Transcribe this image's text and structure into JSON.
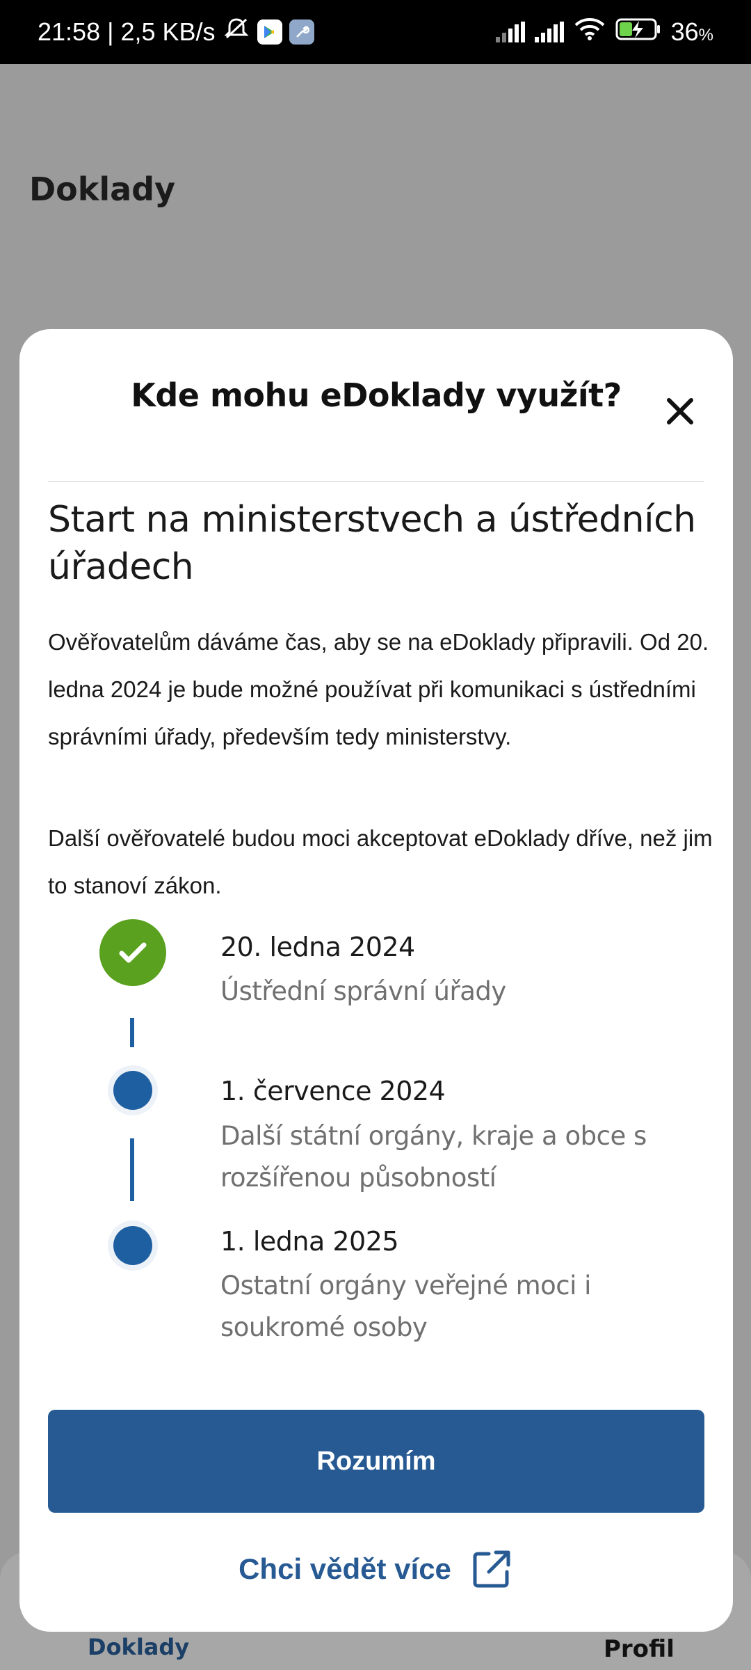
{
  "status_bar": {
    "time_speed": "21:58 | 2,5 KB/s",
    "battery": "36",
    "battery_unit": "%",
    "icons": [
      "mute-icon",
      "play-store-icon",
      "wrench-icon",
      "signal-icon",
      "signal-icon",
      "wifi-icon",
      "battery-charging-icon"
    ]
  },
  "background": {
    "title": "Doklady",
    "nav": {
      "docs": "Doklady",
      "profile": "Profil"
    }
  },
  "sheet": {
    "title": "Kde mohu eDoklady využít?",
    "heading": "Start na ministerstvech a ústředních úřadech",
    "paragraph1": "Ověřovatelům dáváme čas, aby se na eDoklady připravili. Od 20. ledna 2024 je bude možné používat při komunikaci s ústředními správními úřady, především tedy ministerstvy.",
    "paragraph2": "Další ověřovatelé budou moci akceptovat eDoklady dříve, než jim to stanoví zákon.",
    "timeline": [
      {
        "date": "20. ledna 2024",
        "desc": "Ústřední správní úřady",
        "done": true
      },
      {
        "date": "1. července 2024",
        "desc": "Další státní orgány, kraje a obce s rozšířenou působností",
        "done": false
      },
      {
        "date": "1. ledna 2025",
        "desc": "Ostatní orgány veřejné moci i soukromé osoby",
        "done": false
      }
    ],
    "primary_button": "Rozumím",
    "more_link": "Chci vědět více"
  },
  "colors": {
    "primary": "#275a93",
    "done": "#5aa11f",
    "dot": "#1d5fa0"
  }
}
